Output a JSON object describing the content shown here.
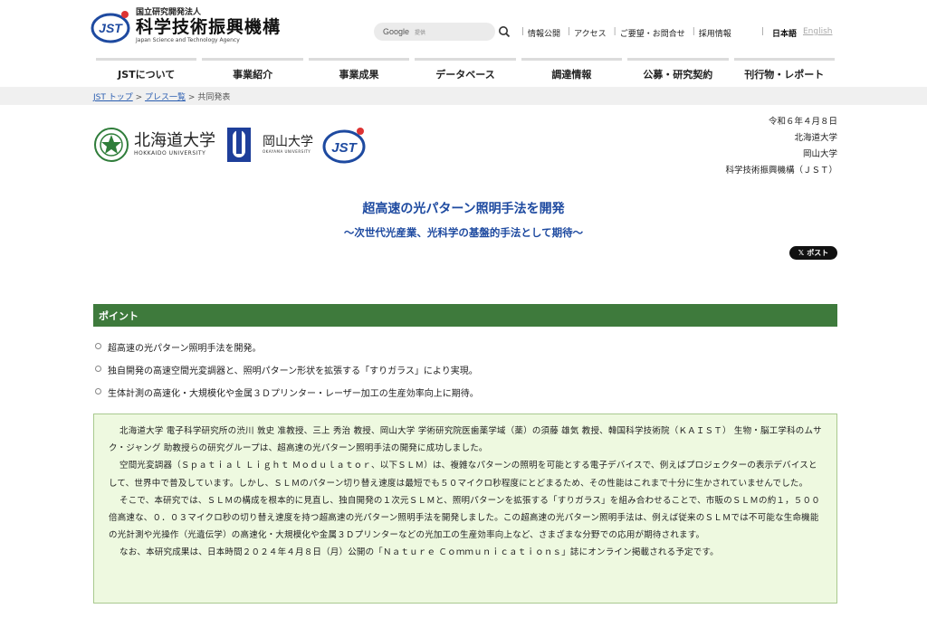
{
  "header": {
    "org_small": "国立研究開発法人",
    "org_name": "科学技術振興機構",
    "org_english": "Japan Science and Technology Agency",
    "logo_letters": "JST",
    "search_brand": "Google",
    "search_placeholder": "提供",
    "utility_links": [
      "情報公開",
      "アクセス",
      "ご要望・お問合せ",
      "採用情報"
    ],
    "lang_ja": "日本語",
    "lang_en": "English"
  },
  "nav": {
    "items": [
      "JSTについて",
      "事業紹介",
      "事業成果",
      "データベース",
      "調達情報",
      "公募・研究契約",
      "刊行物・レポート"
    ]
  },
  "breadcrumb": {
    "home": "JST トップ",
    "press": "プレス一覧",
    "current": "共同発表"
  },
  "partners": {
    "hokkaido_ja": "北海道大学",
    "hokkaido_en": "HOKKAIDO UNIVERSITY",
    "okayama_ja": "岡山大学",
    "okayama_en": "OKAYAMA UNIVERSITY",
    "jst": "JST"
  },
  "meta": {
    "date": "令和６年４月８日",
    "org1": "北海道大学",
    "org2": "岡山大学",
    "org3": "科学技術振興機構（ＪＳＴ）"
  },
  "article": {
    "title": "超高速の光パターン照明手法を開発",
    "subtitle": "～次世代光産業、光科学の基盤的手法として期待～",
    "post_label": "ポスト"
  },
  "points": {
    "heading": "ポイント",
    "items": [
      "超高速の光パターン照明手法を開発。",
      "独自開発の高速空間光変調器と、照明パターン形状を拡張する「すりガラス」により実現。",
      "生体計測の高速化・大規模化や金属３Ｄプリンター・レーザー加工の生産効率向上に期待。"
    ]
  },
  "summary": {
    "paragraphs": [
      "北海道大学 電子科学研究所の渋川 敦史 准教授、三上 秀治 教授、岡山大学 学術研究院医歯薬学域（薬）の須藤 雄気 教授、韓国科学技術院（ＫＡＩＳＴ） 生物・脳工学科のムサク・ジャング 助教授らの研究グループは、超高速の光パターン照明手法の開発に成功しました。",
      "空間光変調器（Ｓｐａｔｉａｌ Ｌｉｇｈｔ Ｍｏｄｕｌａｔｏｒ、以下ＳＬＭ）は、複雑なパターンの照明を可能とする電子デバイスで、例えばプロジェクターの表示デバイスとして、世界中で普及しています。しかし、ＳＬＭのパターン切り替え速度は最短でも５０マイクロ秒程度にとどまるため、その性能はこれまで十分に生かされていませんでした。",
      "そこで、本研究では、ＳＬＭの構成を根本的に見直し、独自開発の１次元ＳＬＭと、照明パターンを拡張する「すりガラス」を組み合わせることで、市販のＳＬＭの約１，５００倍高速な、０．０３マイクロ秒の切り替え速度を持つ超高速の光パターン照明手法を開発しました。この超高速の光パターン照明手法は、例えば従来のＳＬＭでは不可能な生命機能の光計測や光操作（光遺伝学）の高速化・大規模化や金属３Ｄプリンターなどの光加工の生産効率向上など、さまざまな分野での応用が期待されます。",
      "なお、本研究成果は、日本時間２０２４年４月８日（月）公開の「Ｎａｔｕｒｅ Ｃｏｍｍｕｎｉｃａｔｉｏｎｓ」誌にオンライン掲載される予定です。"
    ]
  },
  "colors": {
    "brand_blue": "#1e4aa0",
    "point_green": "#3e7a3c",
    "summary_bg": "#eef9e0"
  }
}
